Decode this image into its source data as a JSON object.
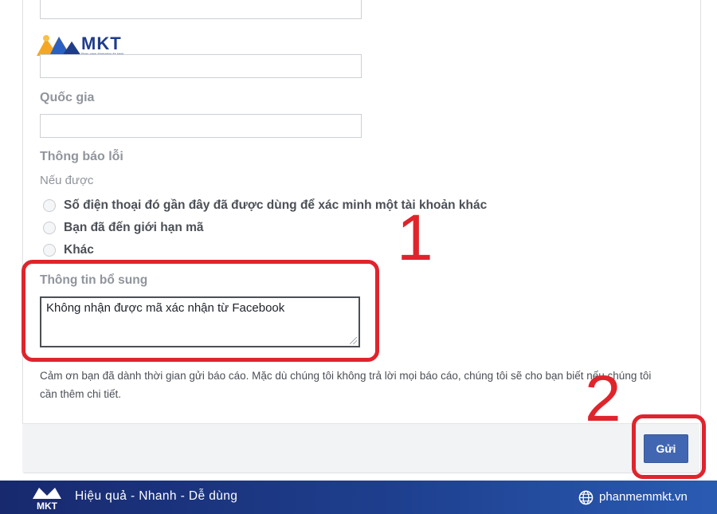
{
  "form": {
    "country_label": "Quốc gia",
    "error_label": "Thông báo lỗi",
    "if_label": "Nếu được",
    "options": [
      "Số điện thoại đó gần đây đã được dùng để xác minh một tài khoản khác",
      "Bạn đã đến giới hạn mã",
      "Khác"
    ],
    "extra_label": "Thông tin bổ sung",
    "extra_value": "Không nhận được mã xác nhận từ Facebook",
    "note": "Cảm ơn bạn đã dành thời gian gửi báo cáo. Mặc dù chúng tôi không trả lời mọi báo cáo, chúng tôi sẽ cho bạn biết nếu chúng tôi cần thêm chi tiết.",
    "submit_label": "Gửi"
  },
  "annotations": {
    "step1": "1",
    "step2": "2",
    "color": "#e0242c"
  },
  "brand": {
    "logo_text": "MKT",
    "logo_tagline": "Phần mềm Marketing đa kênh",
    "slogan": "Hiệu quả - Nhanh - Dễ dùng",
    "website": "phanmemmkt.vn",
    "banner_color": "#1e3f8e"
  },
  "theme": {
    "button_color": "#4267b2"
  }
}
